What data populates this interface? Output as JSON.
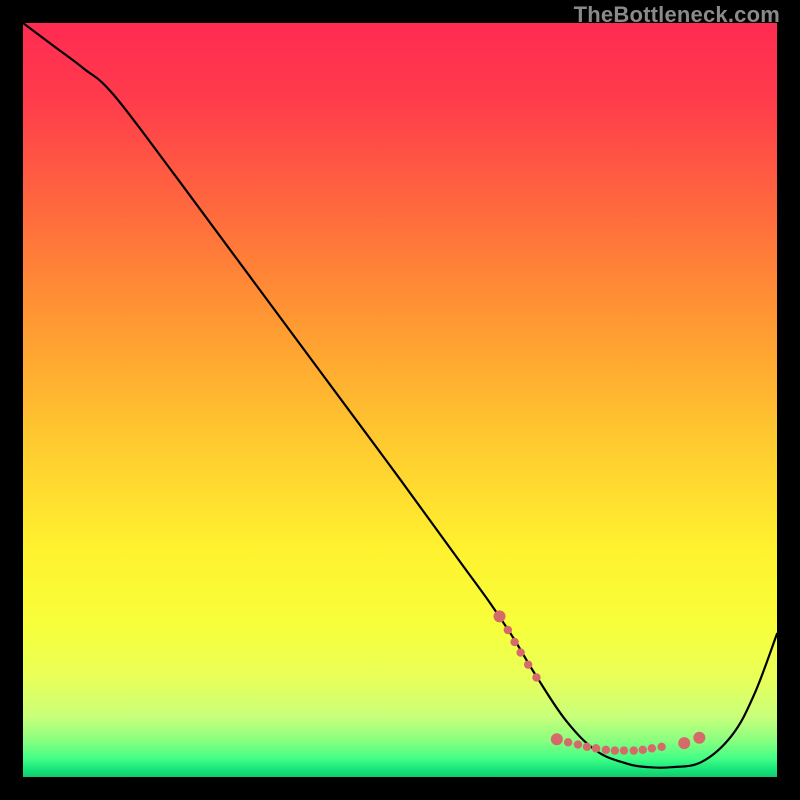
{
  "watermark": "TheBottleneck.com",
  "chart_data": {
    "type": "line",
    "title": "",
    "xlabel": "",
    "ylabel": "",
    "xlim": [
      0,
      100
    ],
    "ylim": [
      0,
      100
    ],
    "grid": false,
    "legend": false,
    "background_gradient": {
      "stops": [
        {
          "offset": 0.0,
          "color": "#ff2b52"
        },
        {
          "offset": 0.1,
          "color": "#ff3b4c"
        },
        {
          "offset": 0.25,
          "color": "#ff6a3d"
        },
        {
          "offset": 0.4,
          "color": "#ff9a32"
        },
        {
          "offset": 0.55,
          "color": "#ffc82f"
        },
        {
          "offset": 0.7,
          "color": "#fff22f"
        },
        {
          "offset": 0.8,
          "color": "#f7ff3a"
        },
        {
          "offset": 0.87,
          "color": "#e8ff5a"
        },
        {
          "offset": 0.92,
          "color": "#c8ff7a"
        },
        {
          "offset": 0.95,
          "color": "#8dff7f"
        },
        {
          "offset": 0.975,
          "color": "#44ff86"
        },
        {
          "offset": 0.99,
          "color": "#17e57a"
        },
        {
          "offset": 1.0,
          "color": "#12c96b"
        }
      ]
    },
    "series": [
      {
        "name": "bottleneck-curve",
        "color": "#000000",
        "x": [
          0,
          4,
          8,
          12,
          20,
          30,
          40,
          50,
          58,
          62,
          65,
          68,
          72,
          76,
          80,
          83,
          86,
          90,
          94,
          97,
          100
        ],
        "y": [
          100,
          97,
          94,
          90.5,
          80,
          66.5,
          53,
          39.5,
          28.5,
          23,
          18.5,
          13.5,
          7.5,
          3.5,
          1.8,
          1.3,
          1.3,
          2.0,
          5.5,
          11,
          19
        ]
      }
    ],
    "markers": {
      "name": "highlight-dots",
      "color": "#d66a6a",
      "radius_small": 4.2,
      "radius_large": 6.0,
      "points": [
        {
          "x": 63.2,
          "y": 21.3,
          "r": "large"
        },
        {
          "x": 64.3,
          "y": 19.5,
          "r": "small"
        },
        {
          "x": 65.2,
          "y": 17.9,
          "r": "small"
        },
        {
          "x": 66.0,
          "y": 16.5,
          "r": "small"
        },
        {
          "x": 67.0,
          "y": 14.9,
          "r": "small"
        },
        {
          "x": 68.1,
          "y": 13.2,
          "r": "small"
        },
        {
          "x": 70.8,
          "y": 5.0,
          "r": "large"
        },
        {
          "x": 72.3,
          "y": 4.6,
          "r": "small"
        },
        {
          "x": 73.6,
          "y": 4.3,
          "r": "small"
        },
        {
          "x": 74.8,
          "y": 4.0,
          "r": "small"
        },
        {
          "x": 76.0,
          "y": 3.8,
          "r": "small"
        },
        {
          "x": 77.3,
          "y": 3.6,
          "r": "small"
        },
        {
          "x": 78.5,
          "y": 3.5,
          "r": "small"
        },
        {
          "x": 79.7,
          "y": 3.5,
          "r": "small"
        },
        {
          "x": 81.0,
          "y": 3.5,
          "r": "small"
        },
        {
          "x": 82.2,
          "y": 3.6,
          "r": "small"
        },
        {
          "x": 83.4,
          "y": 3.8,
          "r": "small"
        },
        {
          "x": 84.7,
          "y": 4.0,
          "r": "small"
        },
        {
          "x": 87.7,
          "y": 4.5,
          "r": "large"
        },
        {
          "x": 89.7,
          "y": 5.2,
          "r": "large"
        }
      ]
    }
  }
}
